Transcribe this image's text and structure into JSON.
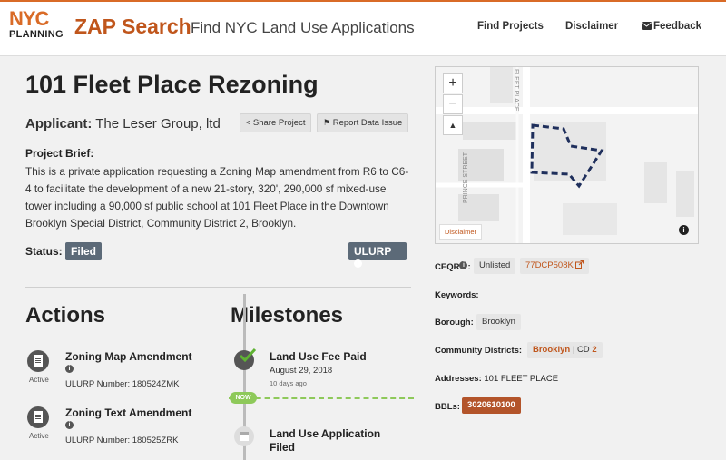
{
  "header": {
    "logo_top": "NYC",
    "logo_bottom": "PLANNING",
    "brand": "ZAP Search",
    "tagline": "Find NYC Land Use Applications",
    "nav": {
      "find": "Find Projects",
      "disclaimer": "Disclaimer",
      "feedback": "Feedback"
    }
  },
  "project": {
    "title": "101 Fleet Place Rezoning",
    "applicant_label": "Applicant:",
    "applicant": "The Leser Group, ltd",
    "share": "Share Project",
    "report": "Report Data Issue",
    "brief_label": "Project Brief:",
    "brief": "This is a private application requesting a Zoning Map amendment from R6 to C6-4 to facilitate the development of a new 21-story, 320', 290,000 sf mixed-use tower including a 90,000 sf public school at 101 Fleet Place in the Downtown Brooklyn Special District, Community District 2, Brooklyn.",
    "status_label": "Status:",
    "status": "Filed",
    "ulurp": "ULURP"
  },
  "actions": {
    "heading": "Actions",
    "items": [
      {
        "title": "Zoning Map Amendment",
        "state": "Active",
        "number": "ULURP Number: 180524ZMK"
      },
      {
        "title": "Zoning Text Amendment",
        "state": "Active",
        "number": "ULURP Number: 180525ZRK"
      }
    ]
  },
  "milestones": {
    "heading": "Milestones",
    "now": "NOW",
    "items": [
      {
        "title": "Land Use Fee Paid",
        "date": "August 29, 2018",
        "ago": "10 days ago"
      },
      {
        "title_line1": "Land Use Application",
        "title_line2": "Filed"
      }
    ]
  },
  "map": {
    "street1": "FLEET PLACE",
    "street2": "PRINCE STREET",
    "zoom_in": "+",
    "zoom_out": "−",
    "compass": "▲",
    "disclaimer": "Disclaimer"
  },
  "details": {
    "ceqr_label": "CEQR",
    "ceqr_status": "Unlisted",
    "ceqr_number": "77DCP508K",
    "keywords_label": "Keywords:",
    "borough_label": "Borough:",
    "borough": "Brooklyn",
    "cd_label": "Community Districts:",
    "cd_borough": "Brooklyn",
    "cd_sep": "|",
    "cd_text": "CD",
    "cd_number": "2",
    "addresses_label": "Addresses:",
    "address": "101 FLEET PLACE",
    "bbls_label": "BBLs:",
    "bbl": "3020610100"
  },
  "colors": {
    "brand": "#c0561c",
    "accent": "#d96b27",
    "status": "#5c6a78",
    "now": "#8ec95a",
    "boundary": "#1f2f5c"
  },
  "icons": [
    "share-icon",
    "flag-icon",
    "envelope-icon",
    "info-icon",
    "document-icon",
    "check-icon",
    "calendar-icon",
    "external-link-icon"
  ]
}
